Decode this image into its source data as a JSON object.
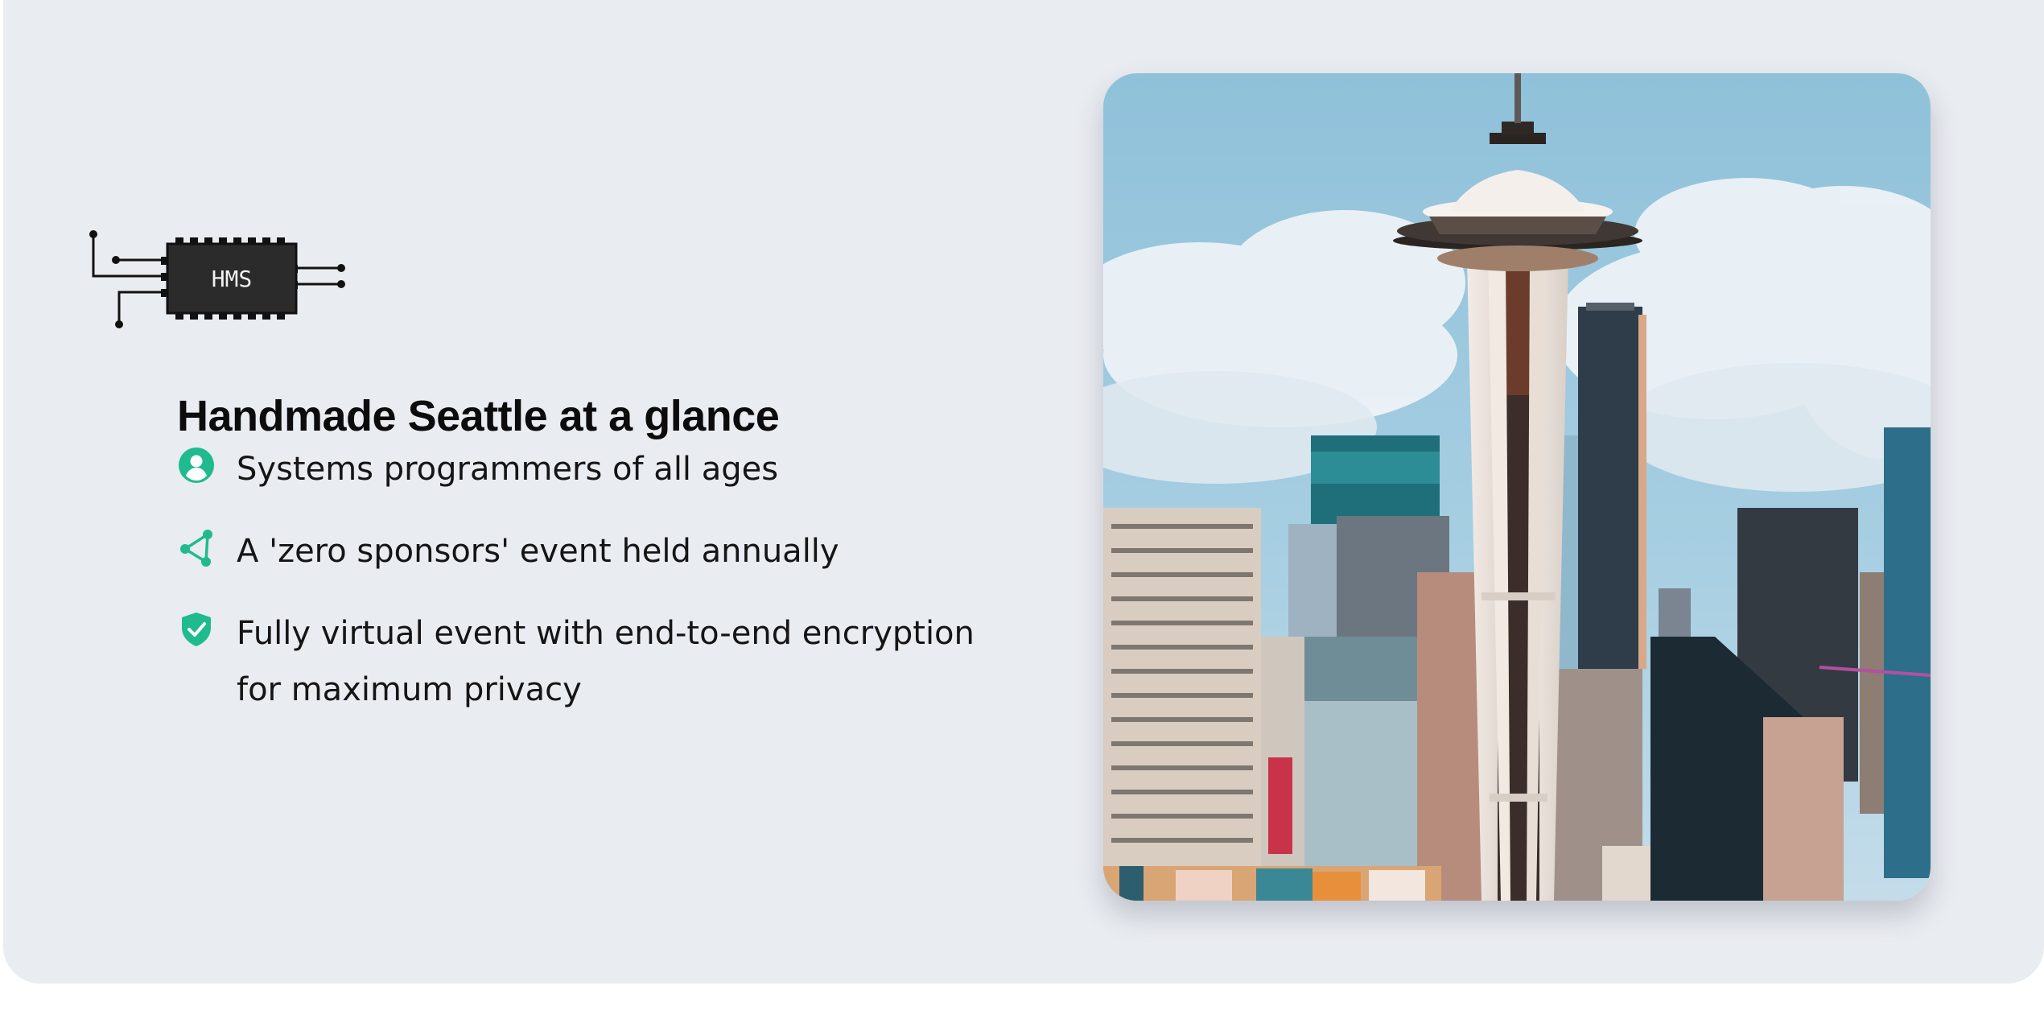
{
  "logo": {
    "chip_label": "HMS",
    "icon": "circuit-chip-icon"
  },
  "heading": "Handmade Seattle at a glance",
  "features": [
    {
      "icon": "user-circle-icon",
      "text": "Systems programmers of all ages"
    },
    {
      "icon": "share-nodes-icon",
      "text": "A 'zero sponsors' event held annually"
    },
    {
      "icon": "shield-check-icon",
      "text": "Fully virtual event with end-to-end encryption for maximum privacy"
    }
  ],
  "photo": {
    "subject": "seattle-skyline-space-needle"
  },
  "colors": {
    "accent": "#1fbb8f",
    "card_background": "#e9ecf1",
    "heading": "#0c0c0c",
    "body_text": "#151515"
  }
}
